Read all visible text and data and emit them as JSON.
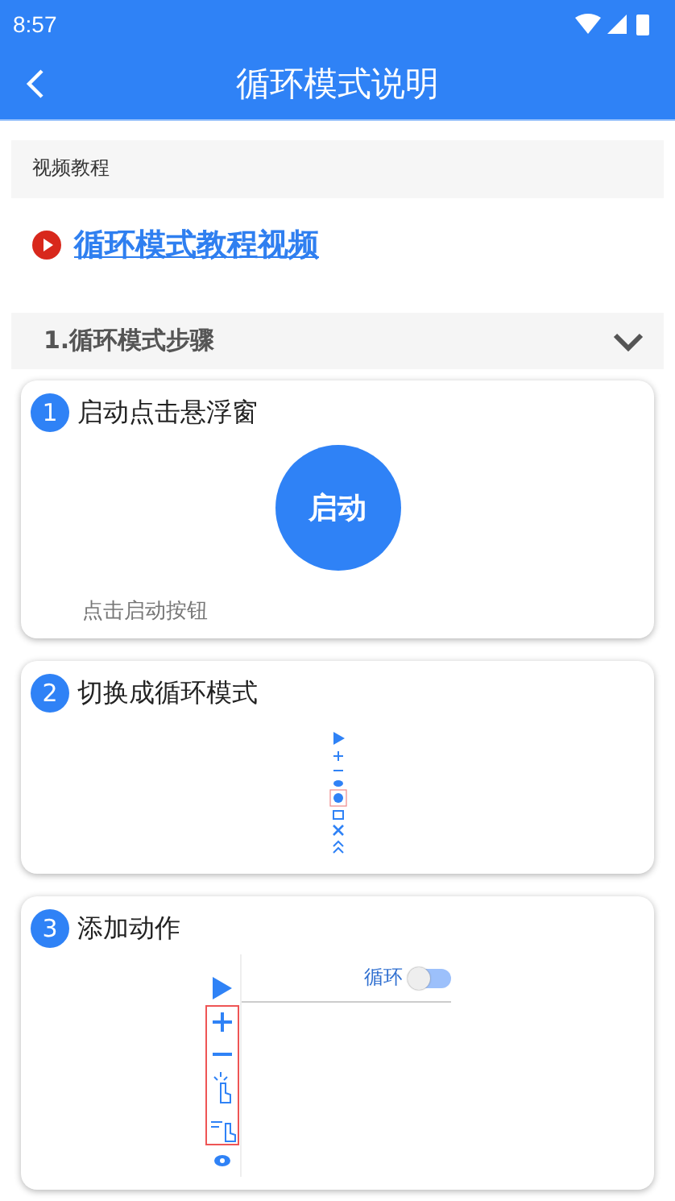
{
  "status_bar": {
    "time": "8:57"
  },
  "app_bar": {
    "title": "循环模式说明"
  },
  "video_section": {
    "heading": "视频教程",
    "link": "循环模式教程视频"
  },
  "accordion": {
    "title": "1.循环模式步骤",
    "expanded": true
  },
  "steps": [
    {
      "kind": "start",
      "number": "1",
      "title": "启动点击悬浮窗",
      "button": "启动",
      "caption": "点击启动按钮"
    },
    {
      "kind": "toolbar",
      "number": "2",
      "title": "切换成循环模式"
    },
    {
      "kind": "editor",
      "number": "3",
      "title": "添加动作",
      "switch": {
        "label": "循环",
        "on": false
      }
    }
  ]
}
